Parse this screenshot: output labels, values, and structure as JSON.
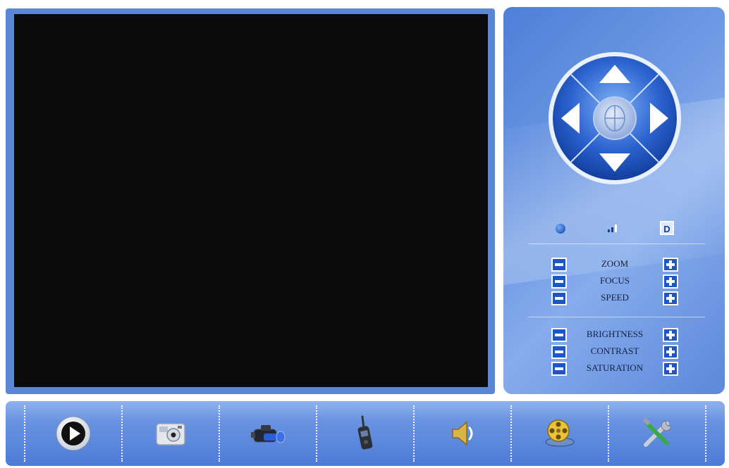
{
  "controls": {
    "ptz": [
      "ZOOM",
      "FOCUS",
      "SPEED"
    ],
    "image": [
      "BRIGHTNESS",
      "CONTRAST",
      "SATURATION"
    ]
  },
  "status_icons": {
    "d_label": "D"
  },
  "toolbar": {
    "icons": [
      "play-icon",
      "snapshot-camera-icon",
      "video-camera-icon",
      "walkie-talkie-icon",
      "speaker-icon",
      "film-reel-icon",
      "tools-icon"
    ]
  },
  "colors": {
    "panel_blue": "#5b86d6",
    "button_blue": "#1f56c6",
    "screen_black": "#0b0b0b"
  }
}
